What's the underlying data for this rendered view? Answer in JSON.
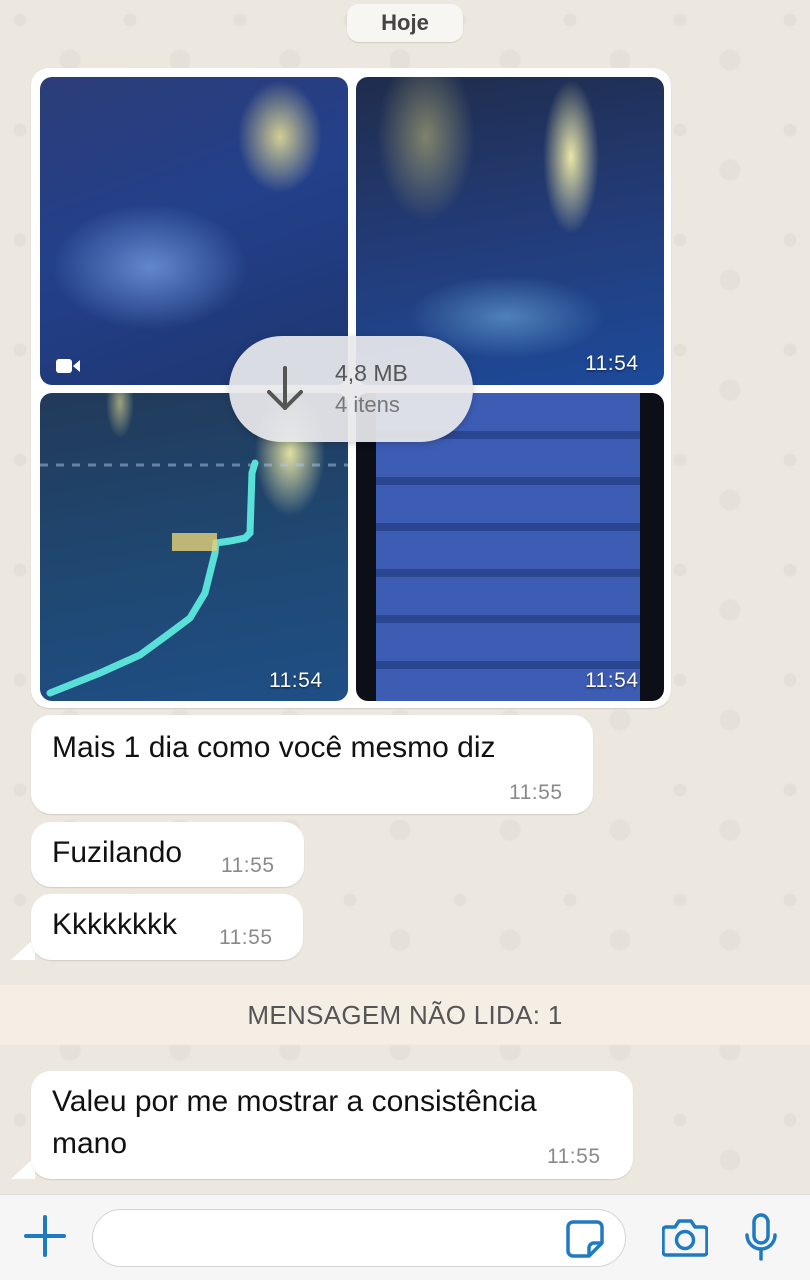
{
  "chat": {
    "date_label": "Hoje",
    "media_group": {
      "download_size": "4,8 MB",
      "item_count": "4 itens",
      "thumbnails": [
        {
          "type": "video",
          "time": ""
        },
        {
          "type": "image",
          "time": "11:54"
        },
        {
          "type": "image",
          "time": "11:54"
        },
        {
          "type": "image",
          "time": "11:54"
        }
      ]
    },
    "messages": [
      {
        "text": "Mais 1 dia como você mesmo diz",
        "time": "11:55"
      },
      {
        "text": "Fuzilando",
        "time": "11:55"
      },
      {
        "text": "Kkkkkkkk",
        "time": "11:55"
      },
      {
        "text_line1": "Valeu por me mostrar a consistência",
        "text_line2": "mano",
        "time": "11:55"
      }
    ],
    "unread_banner": "MENSAGEM NÃO LIDA: 1"
  },
  "composer": {
    "placeholder": "",
    "icons": [
      "plus-icon",
      "sticker-icon",
      "camera-icon",
      "microphone-icon"
    ],
    "accent_color": "#1f7ac2"
  }
}
